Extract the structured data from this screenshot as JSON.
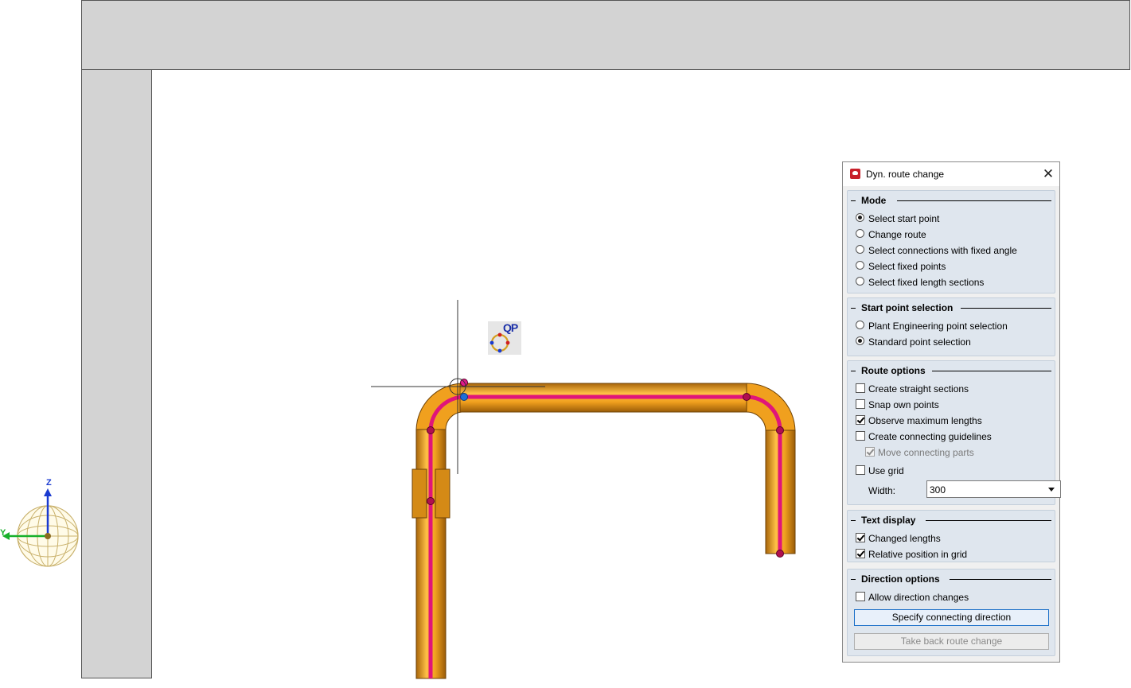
{
  "colors": {
    "pipe": "#f0a01e",
    "pipe_dark": "#b36f0e",
    "centerline": "#e0157a",
    "wall": "#d3d3d3",
    "dialog_bg": "#f0f0f0",
    "group_bg": "#dfe6ee",
    "button_accent": "#1a6fc8"
  },
  "viewport": {
    "cursor": "crosshair-cursor",
    "qp_badge": "QP",
    "axis_labels": {
      "z": "Z",
      "y": "Y"
    }
  },
  "dialog": {
    "title": "Dyn. route change",
    "close": "✕",
    "mode": {
      "title": "Mode",
      "options": [
        {
          "label": "Select start point",
          "selected": true
        },
        {
          "label": "Change route",
          "selected": false
        },
        {
          "label": "Select connections with fixed angle",
          "selected": false
        },
        {
          "label": "Select fixed points",
          "selected": false
        },
        {
          "label": "Select fixed length sections",
          "selected": false
        }
      ]
    },
    "start_point": {
      "title": "Start point selection",
      "options": [
        {
          "label": "Plant Engineering point selection",
          "selected": false
        },
        {
          "label": "Standard point selection",
          "selected": true
        }
      ]
    },
    "route_options": {
      "title": "Route options",
      "items": [
        {
          "label": "Create straight sections",
          "checked": false
        },
        {
          "label": "Snap own points",
          "checked": false
        },
        {
          "label": "Observe maximum lengths",
          "checked": true
        },
        {
          "label": "Create connecting guidelines",
          "checked": false
        },
        {
          "label": "Move connecting parts",
          "checked": true,
          "disabled": true
        },
        {
          "label": "Use grid",
          "checked": false
        }
      ],
      "width_label": "Width:",
      "width_value": "300"
    },
    "text_display": {
      "title": "Text display",
      "items": [
        {
          "label": "Changed lengths",
          "checked": true
        },
        {
          "label": "Relative position in grid",
          "checked": true
        }
      ]
    },
    "direction_options": {
      "title": "Direction options",
      "items": [
        {
          "label": "Allow direction changes",
          "checked": false
        }
      ],
      "specify_button": "Specify connecting direction",
      "take_back_button": "Take back route change"
    }
  }
}
